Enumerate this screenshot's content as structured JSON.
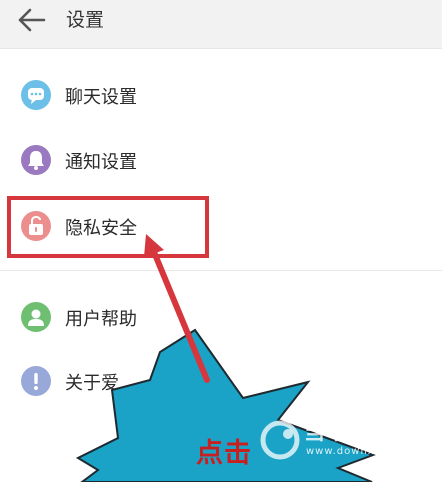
{
  "header": {
    "title": "设置",
    "back_icon": "back-arrow-icon"
  },
  "menu": [
    {
      "label": "聊天设置",
      "icon": "chat-bubble-icon",
      "color": "#6cc0e8"
    },
    {
      "label": "通知设置",
      "icon": "bell-icon",
      "color": "#9b79c0"
    },
    {
      "label": "隐私安全",
      "icon": "lock-icon",
      "color": "#ec8e8e"
    },
    {
      "label": "用户帮助",
      "icon": "user-icon",
      "color": "#6fbf73"
    },
    {
      "label": "关于爱",
      "icon": "info-icon",
      "color": "#98a8d8"
    }
  ],
  "annotation": {
    "text": "点击",
    "highlight_color": "#d6373d",
    "burst_color": "#1aa3c7"
  },
  "watermark": {
    "name": "当下软件园",
    "url": "www.downxia.com"
  }
}
